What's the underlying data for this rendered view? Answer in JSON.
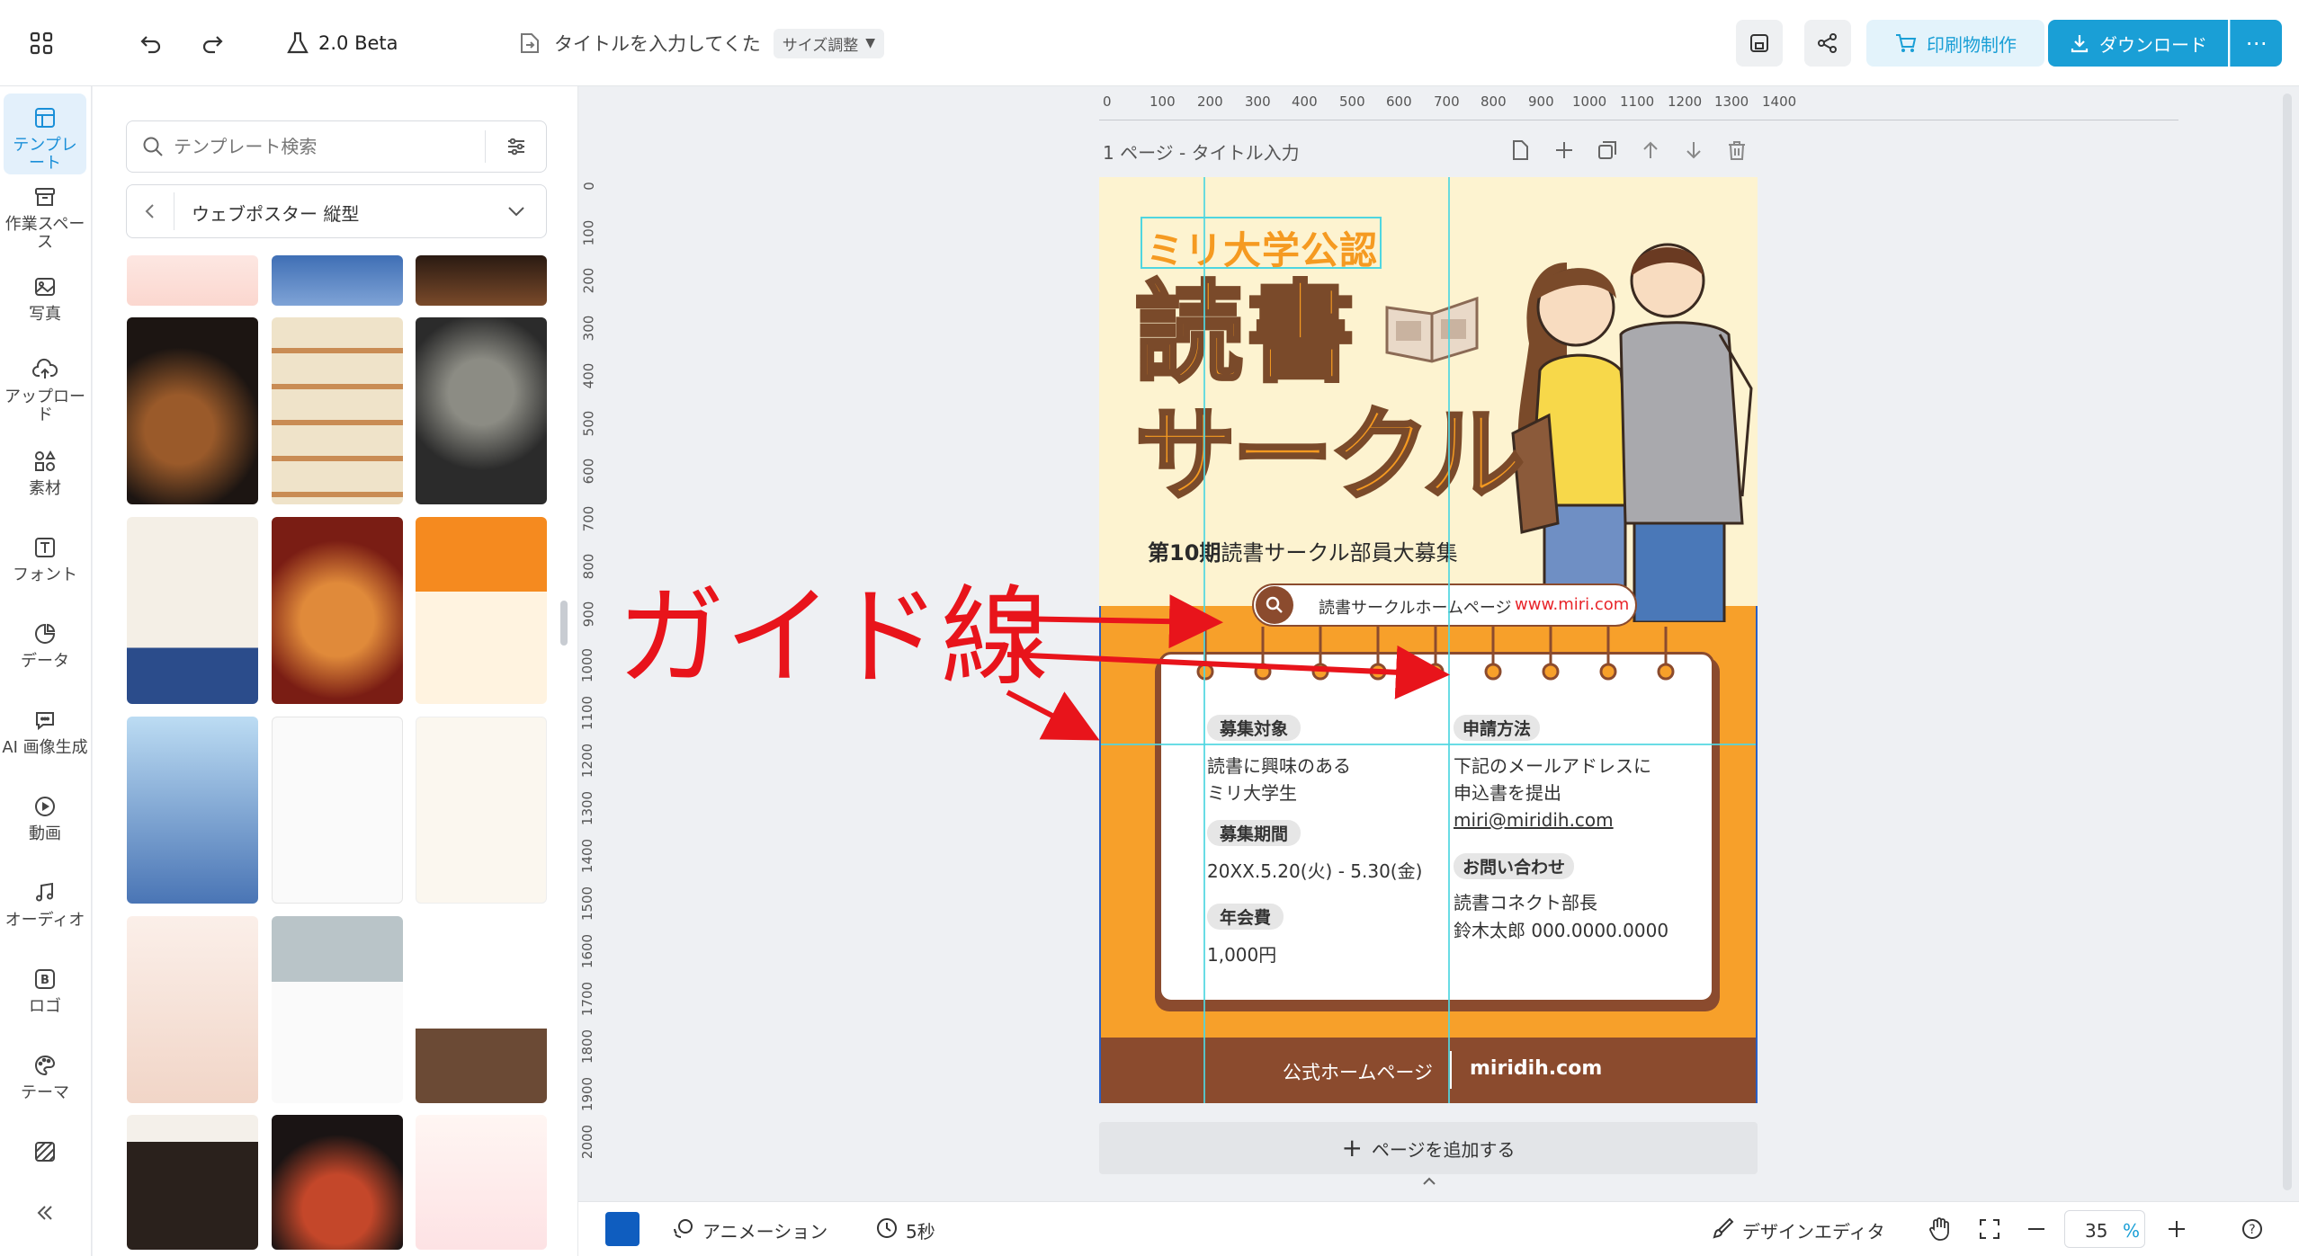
{
  "toolbar": {
    "version": "2.0 Beta",
    "title_placeholder": "タイトルを入力してくた",
    "size_adjust": "サイズ調整",
    "print_label": "印刷物制作",
    "download_label": "ダウンロード"
  },
  "nav": [
    {
      "label": "テンプレート",
      "icon": "template-icon"
    },
    {
      "label": "作業スペース",
      "icon": "workspace-icon"
    },
    {
      "label": "写真",
      "icon": "photo-icon"
    },
    {
      "label": "アップロード",
      "icon": "upload-icon"
    },
    {
      "label": "素材",
      "icon": "elements-icon"
    },
    {
      "label": "フォント",
      "icon": "font-icon"
    },
    {
      "label": "データ",
      "icon": "data-icon"
    },
    {
      "label": "AI 画像生成",
      "icon": "ai-image-icon"
    },
    {
      "label": "動画",
      "icon": "video-icon"
    },
    {
      "label": "オーディオ",
      "icon": "audio-icon"
    },
    {
      "label": "ロゴ",
      "icon": "logo-icon"
    },
    {
      "label": "テーマ",
      "icon": "theme-icon"
    }
  ],
  "panel": {
    "search_placeholder": "テンプレート検索",
    "category": "ウェブポスター 縦型"
  },
  "page": {
    "header": "1 ページ - タイトル入力",
    "add_page": "ページを追加する"
  },
  "ruler": {
    "h": [
      "0",
      "100",
      "200",
      "300",
      "400",
      "500",
      "600",
      "700",
      "800",
      "900",
      "1000",
      "1100",
      "1200",
      "1300",
      "1400"
    ],
    "v": [
      "0",
      "100",
      "200",
      "300",
      "400",
      "500",
      "600",
      "700",
      "800",
      "900",
      "1000",
      "1100",
      "1200",
      "1300",
      "1400",
      "1500",
      "1600",
      "1700",
      "1800",
      "1900",
      "2000"
    ]
  },
  "poster": {
    "badge": "ミリ大学公認",
    "title1": "読書",
    "title2": "サークル",
    "subtitle_em": "第10期",
    "subtitle_rest": "読書サークル部員大募集",
    "hp_label": "読書サークルホームページ",
    "hp_url": "www.miri.com",
    "recruit_target_h": "募集対象",
    "recruit_target": [
      "読書に興味のある",
      "ミリ大学生"
    ],
    "period_h": "募集期間",
    "period": "20XX.5.20(火) - 5.30(金)",
    "fee_h": "年会費",
    "fee": "1,000円",
    "apply_h": "申請方法",
    "apply": [
      "下記のメールアドレスに",
      "申込書を提出"
    ],
    "apply_mail": "miri@miridih.com",
    "contact_h": "お問い合わせ",
    "contact": [
      "読書コネクト部長",
      "鈴木太郎 000.0000.0000"
    ],
    "footer_left": "公式ホームページ",
    "footer_right": "miridih.com"
  },
  "annotation": "ガイド線",
  "bottom": {
    "animation": "アニメーション",
    "duration": "5秒",
    "design_editor": "デザインエディタ",
    "zoom": "35",
    "zoom_unit": "%"
  },
  "colors": {
    "accent": "#1a9fd6",
    "poster_orange": "#f7a02a",
    "poster_brown": "#8b4b2e",
    "guide": "#4fd6e0",
    "annotation_red": "#e8141b"
  }
}
